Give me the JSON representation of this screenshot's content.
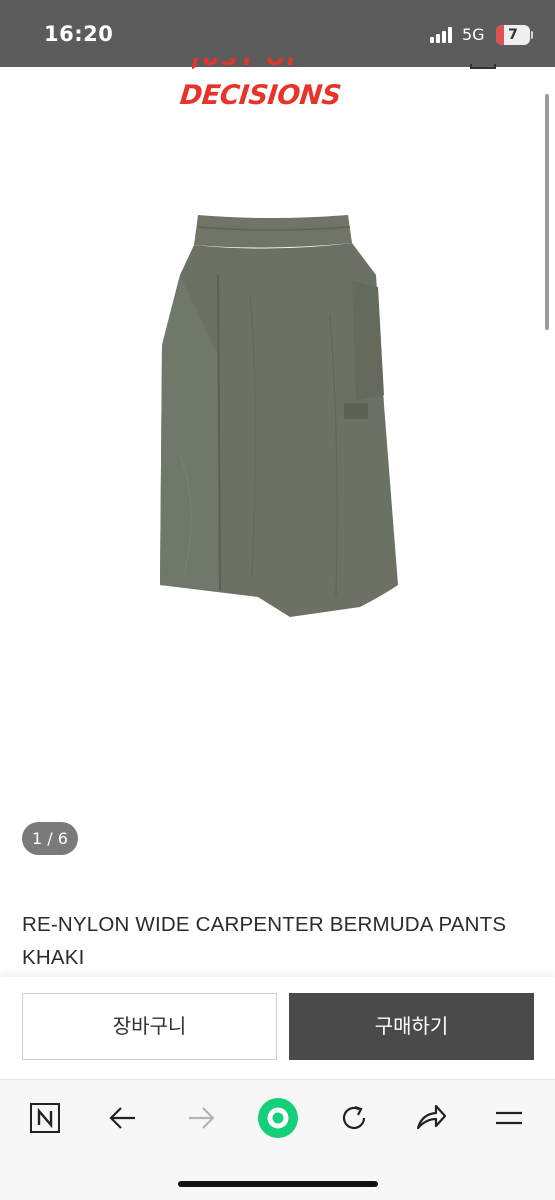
{
  "status_bar": {
    "time": "16:20",
    "network": "5G",
    "battery": "7",
    "battery_color": "#e05252"
  },
  "header": {
    "logo_top": "JUST OF",
    "logo": "DECISIONS",
    "brand_color": "#e8332a"
  },
  "product": {
    "image_icon": "khaki-bermuda-pants-image",
    "image_color": "#6b7263",
    "page_counter": "1 / 6",
    "title_line1": "RE-NYLON WIDE CARPENTER BERMUDA PANTS",
    "title_line2": "KHAKI"
  },
  "purchase_bar": {
    "cart_label": "장바구니",
    "buy_label": "구매하기"
  },
  "browser_bar": {
    "items": [
      "naver-n-icon",
      "back-arrow-icon",
      "forward-arrow-icon",
      "green-dot-icon",
      "reload-icon",
      "share-icon",
      "menu-icon"
    ],
    "accent": "#14d07a"
  }
}
